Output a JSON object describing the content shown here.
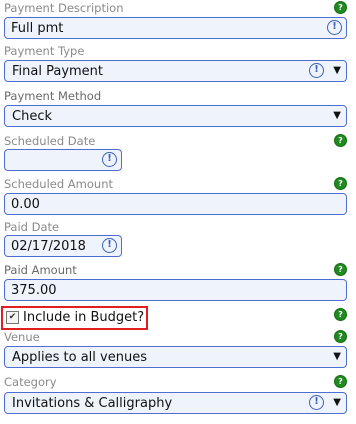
{
  "fields": {
    "payment_description": {
      "label": "Payment Description",
      "value": "Full pmt"
    },
    "payment_type": {
      "label": "Payment Type",
      "value": "Final Payment"
    },
    "payment_method": {
      "label": "Payment Method",
      "value": "Check"
    },
    "scheduled_date": {
      "label": "Scheduled Date",
      "value": ""
    },
    "scheduled_amount": {
      "label": "Scheduled Amount",
      "value": "0.00"
    },
    "paid_date": {
      "label": "Paid Date",
      "value": "02/17/2018"
    },
    "paid_amount": {
      "label": "Paid Amount",
      "value": "375.00"
    },
    "include_budget": {
      "label": "Include in Budget?",
      "checked": true
    },
    "venue": {
      "label": "Venue",
      "value": "Applies to all venues"
    },
    "category": {
      "label": "Category",
      "value": "Invitations & Calligraphy"
    }
  },
  "icons": {
    "help": "?",
    "warning": "!",
    "caret": "▼",
    "check": "✔"
  },
  "colors": {
    "field_border": "#4d6fd1",
    "field_bg": "#eef3fc",
    "help_green": "#1f8a1f",
    "highlight_red": "#e02020"
  }
}
